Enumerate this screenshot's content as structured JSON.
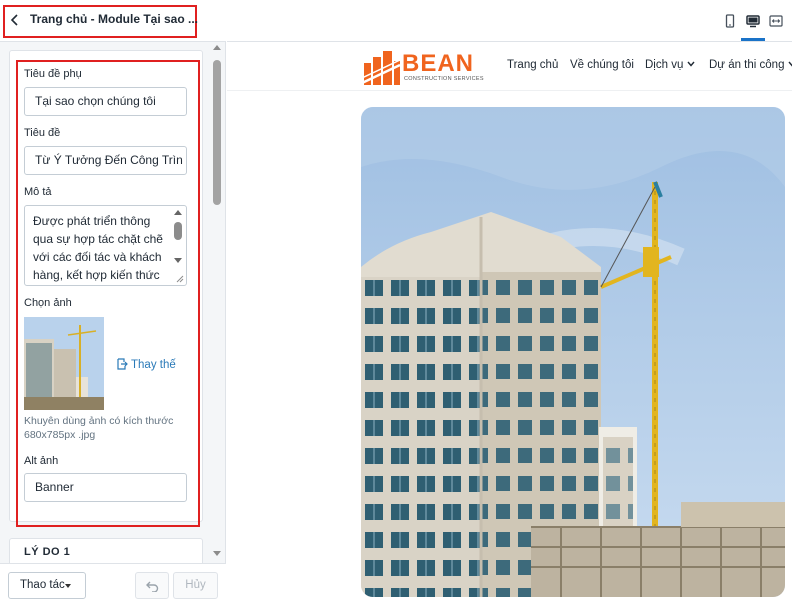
{
  "panel": {
    "title": "Trang chủ - Module Tại sao ...",
    "fields": {
      "subtitle_label": "Tiêu đề phụ",
      "subtitle_value": "Tại sao chọn chúng tôi",
      "title_label": "Tiêu đề",
      "title_value": "Từ Ý Tưởng Đến Công Trìn",
      "desc_label": "Mô tả",
      "desc_value": "Được phát triển thông qua sự hợp tác chặt chẽ với các đối tác và khách hàng, kết hợp kiến thức",
      "image_label": "Chọn ảnh",
      "replace_label": "Thay thế",
      "image_hint": "Khuyên dùng ảnh có kích thước 680x785px .jpg",
      "alt_label": "Alt ảnh",
      "alt_value": "Banner"
    },
    "next_section": "LÝ DO 1",
    "footer": {
      "actions_label": "Thao tác",
      "cancel_label": "Hủy"
    }
  },
  "preview": {
    "brand": {
      "name": "BEAN",
      "tagline": "CONSTRUCTION SERVICES"
    },
    "nav": [
      "Trang chủ",
      "Về chúng tôi",
      "Dịch vụ",
      "Dự án thi công"
    ],
    "colors": {
      "brand_orange": "#f0641e",
      "accent_blue": "#1a73c8",
      "highlight_red": "#e02020"
    }
  },
  "icons": {
    "back": "chevron-left-icon",
    "replace": "replace-icon",
    "undo": "undo-icon",
    "mobile": "mobile-icon",
    "desktop": "desktop-icon",
    "fullwidth": "fullwidth-icon"
  }
}
